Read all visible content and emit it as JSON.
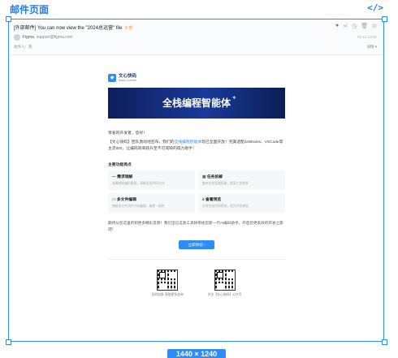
{
  "page": {
    "label": "邮件页面",
    "code_icon": "</>",
    "size_badge": "1440 × 1240"
  },
  "mail": {
    "subject": "[外部邮件] You can now view the \"2024总运营\" file",
    "subject_tag": "外部",
    "sender_name": "Figma",
    "sender_email": "support@figma.com",
    "recipient": "收件人：我",
    "datetime": "01-12 14:32",
    "details_label": "详情 ▾",
    "icons": [
      "settings-icon",
      "share-icon",
      "clock-icon",
      "trash-icon",
      "more-icon"
    ]
  },
  "body": {
    "brand_name": "文心快码",
    "brand_sub": "Baidu Comate",
    "banner_title": "全栈编程智能体",
    "greeting": "亲爱的开发者，您好！",
    "intro_prefix": "【文心快码】团队激动地宣布，我们的",
    "intro_link": "全栈编程智能体",
    "intro_suffix": "现已全面开放！完美适配JetBrains、VSCode等主流IDE，让编码效率跃升至不可或缺的得力助手！",
    "section_title": "主要功能亮点",
    "features": [
      {
        "title": "需求理解",
        "desc": "准确捕捉编码意图，清晰呈现代码方向"
      },
      {
        "title": "任务拆解",
        "desc": "复杂任务智能拆解，提高工作效率"
      },
      {
        "title": "多文件编辑",
        "desc": "跨越多文件同步代码编辑，确保一致性"
      },
      {
        "title": "查看预览",
        "desc": "实时生成代码预览，提升开发体验"
      }
    ],
    "closing": "期待从您这里听到更多精彩反馈！我们坚信这款工具将带给您新一代AI编码助手，开启您更高效的开发之旅吧！",
    "cta_label": "立即体验 ›",
    "qr_left_label": "扫码加群 获取更多咨询",
    "qr_right_label": "关注【文心快码】公众号"
  }
}
